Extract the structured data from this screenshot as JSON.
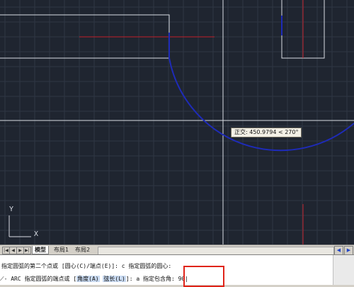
{
  "drawing": {
    "tooltip": "正交: 450.9794 < 270°",
    "ucs_y_label": "Y",
    "ucs_x_label": "X"
  },
  "tabs": {
    "nav_buttons": [
      "|◀",
      "◀",
      "▶",
      "▶|"
    ],
    "items": [
      {
        "label": "模型",
        "active": true
      },
      {
        "label": "布局1",
        "active": false
      },
      {
        "label": "布局2",
        "active": false
      }
    ]
  },
  "command": {
    "history_line": "指定圆弧的第二个点或 [圆心(C)/端点(E)]: c 指定圆弧的圆心:",
    "prompt_icon": "⟋",
    "prompt_prefix": "- ARC 指定圆弧的端点或 [",
    "option_angle": "角度(A)",
    "option_chord": "弦长(L)",
    "prompt_suffix": "]: a 指定包含角:",
    "input_value": "90"
  },
  "colors": {
    "canvas_bg": "#1f2530",
    "grid": "#2f3744",
    "geometry": "#d9dde3",
    "arc": "#1e2bb8",
    "crosshair": "#c0202a",
    "highlight": "#e0241a"
  }
}
